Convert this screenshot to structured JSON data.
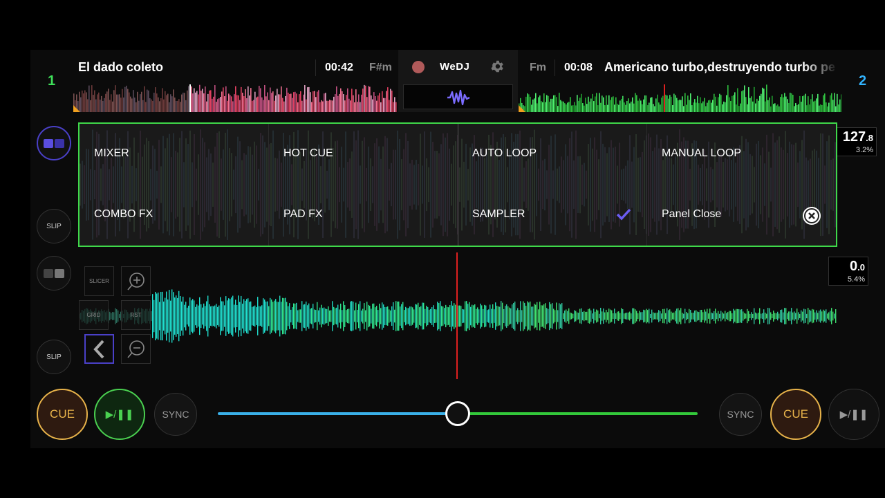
{
  "deck1": {
    "number": "1",
    "title": "El dado coleto",
    "time": "00:42",
    "key": "F#m",
    "bpm_main": "127",
    "bpm_decimal": ".8",
    "pitch": "3.2%",
    "slip_label": "SLIP",
    "playhead_position": 0.36,
    "colors": {
      "accent": "#3fe05a"
    }
  },
  "deck2": {
    "number": "2",
    "title": "Americano turbo,destruyendo turbo pe",
    "time": "00:08",
    "key": "Fm",
    "bpm_main": "0",
    "bpm_decimal": ".0",
    "pitch": "5.4%",
    "slip_label": "SLIP",
    "playhead_position": 0.45,
    "colors": {
      "accent": "#32b4ff"
    }
  },
  "center": {
    "logo": "WeDJ",
    "record_icon": "record-dot-icon",
    "settings_icon": "gear-icon",
    "waveform_toggle_icon": "waveform-icon"
  },
  "panel_menu": {
    "items": [
      "MIXER",
      "HOT CUE",
      "AUTO LOOP",
      "MANUAL LOOP",
      "COMBO FX",
      "PAD FX",
      "SAMPLER",
      "Panel Close"
    ],
    "selected": "SAMPLER",
    "close_icon": "close-circle-icon",
    "border_color": "#3fd84a"
  },
  "tools": {
    "slicer": "SLICER",
    "grid": "GRID",
    "rst": "RST",
    "zoom_in_icon": "zoom-in-icon",
    "zoom_out_icon": "zoom-out-icon",
    "back_icon": "chevron-left-icon"
  },
  "transport": {
    "cue": "CUE",
    "play_pause": "▶/❚❚",
    "sync": "SYNC",
    "crossfader_position": 0.5,
    "colors": {
      "cue": "#e8b34a",
      "play_active": "#4ad050",
      "crossfader_left": "#3ab0e8",
      "crossfader_right": "#33c83a"
    }
  }
}
